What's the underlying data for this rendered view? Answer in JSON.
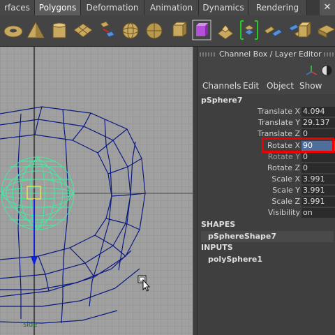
{
  "menu_tabs": [
    {
      "label": "rfaces",
      "active": false
    },
    {
      "label": "Polygons",
      "active": true
    },
    {
      "label": "Deformation",
      "active": false
    },
    {
      "label": "Animation",
      "active": false
    },
    {
      "label": "Dynamics",
      "active": false
    },
    {
      "label": "Rendering",
      "active": false
    }
  ],
  "shelf_icons": [
    "torus-icon",
    "cone-icon",
    "cylinder-icon",
    "plane-icon",
    "combine-icon",
    "sphere-icon",
    "sphere-faces-icon",
    "cube-icon",
    "purple-cube-icon",
    "extrude-icon",
    "split-icon",
    "bridge-icon",
    "merge-icon",
    "append-icon",
    "cube-bevel-icon",
    "plane-extrude-icon"
  ],
  "viewport": {
    "camera_label": "side"
  },
  "channel_box": {
    "panel_title": "Channel Box / Layer Editor",
    "menus": [
      "Channels",
      "Edit",
      "Object",
      "Show"
    ],
    "object_name": "pSphere7",
    "attributes": [
      {
        "label": "Translate X",
        "value": "4.094",
        "dim": false
      },
      {
        "label": "Translate Y",
        "value": "29.137",
        "dim": false
      },
      {
        "label": "Translate Z",
        "value": "0",
        "dim": false
      },
      {
        "label": "Rotate X",
        "value": "90",
        "dim": false,
        "selected": true
      },
      {
        "label": "Rotate Y",
        "value": "0",
        "dim": true
      },
      {
        "label": "Rotate Z",
        "value": "0",
        "dim": false
      },
      {
        "label": "Scale X",
        "value": "3.991",
        "dim": false
      },
      {
        "label": "Scale Y",
        "value": "3.991",
        "dim": false
      },
      {
        "label": "Scale Z",
        "value": "3.991",
        "dim": false
      },
      {
        "label": "Visibility",
        "value": "on",
        "dim": false
      }
    ],
    "shapes_header": "SHAPES",
    "shape_node": "pSphereShape7",
    "inputs_header": "INPUTS",
    "input_node": "polySphere1"
  },
  "colors": {
    "highlight_border": "#e00000",
    "wireframe": "#0a1a80",
    "sphere_wire": "#3cf0a0",
    "selection_field": "#4f6e9c"
  }
}
